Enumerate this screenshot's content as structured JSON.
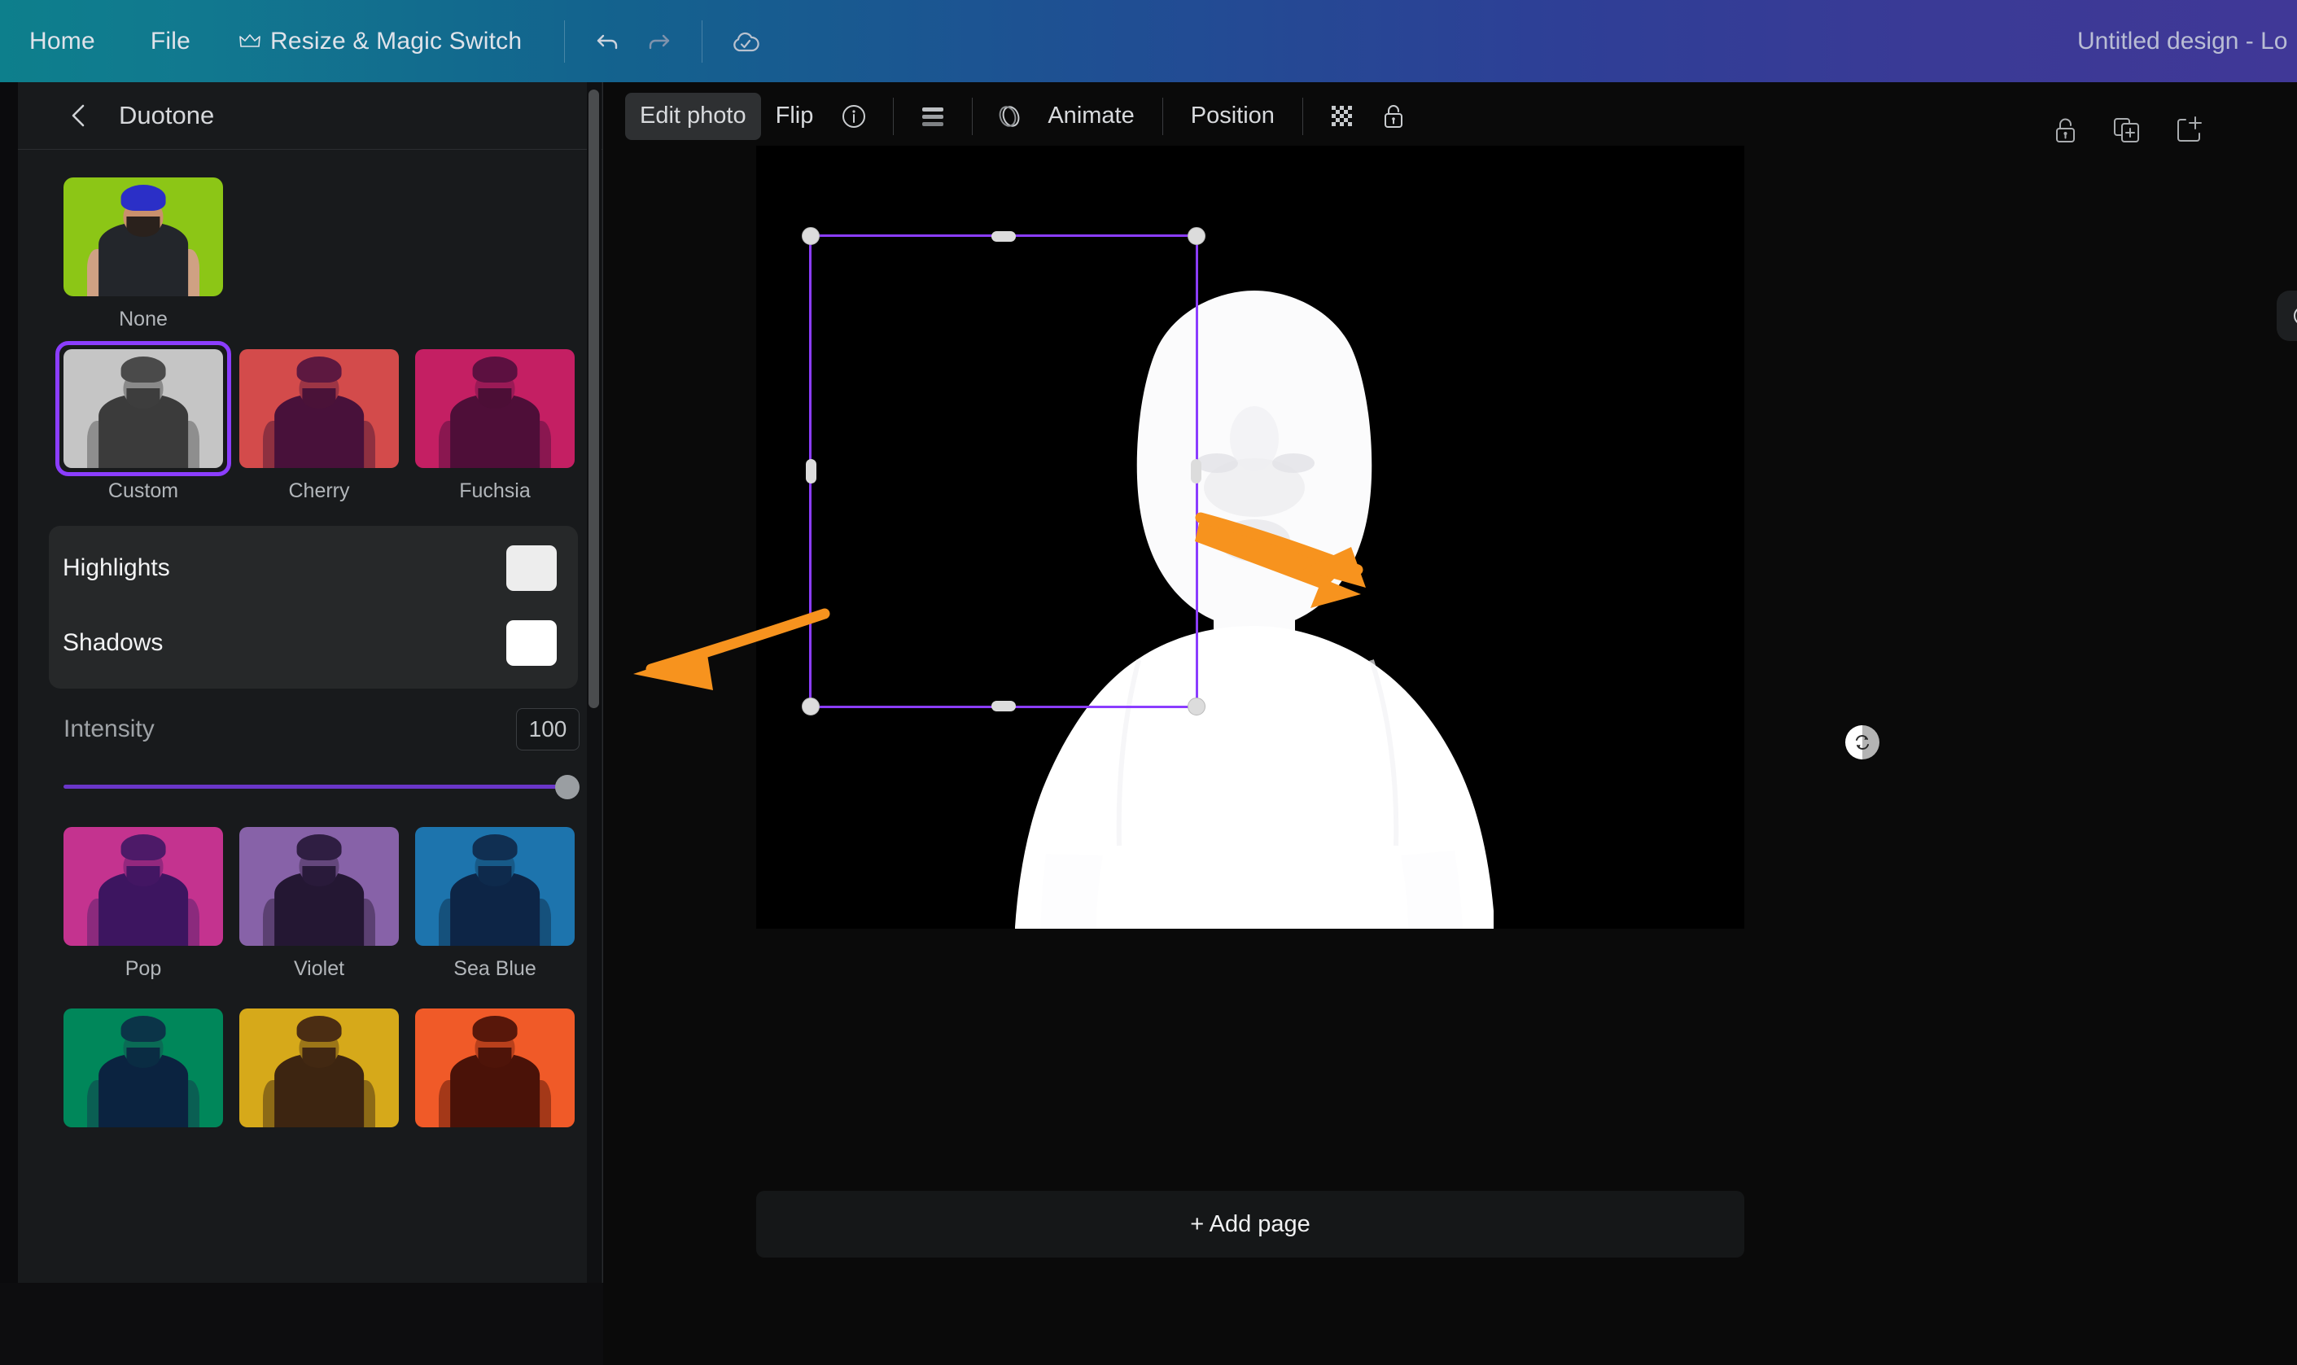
{
  "app": {
    "accent_purple": "#8b3dff",
    "annotation_color": "#f7931e",
    "panel_bg": "#181a1c",
    "canvas_bg": "#0a0a0a"
  },
  "topbar": {
    "menu": [
      {
        "label": "Home",
        "icon": null
      },
      {
        "label": "File",
        "icon": null
      },
      {
        "label": "Resize & Magic Switch",
        "icon": "crown-icon"
      }
    ],
    "undo_icon": "undo-icon",
    "redo_icon": "redo-icon",
    "save_status_icon": "cloud-check-icon",
    "document_title": "Untitled design - Lo"
  },
  "panel": {
    "back_icon": "chevron-left-icon",
    "title": "Duotone",
    "none": {
      "label": "None",
      "bg": "#8cc616",
      "selected": false
    },
    "presets_row1": [
      {
        "label": "Custom",
        "selected": true,
        "bg": "#c9c9c9",
        "fg": "#3a3a3a"
      },
      {
        "label": "Cherry",
        "selected": false,
        "bg": "#d34b4b",
        "fg": "#3f1030"
      },
      {
        "label": "Fuchsia",
        "selected": false,
        "bg": "#c41f63",
        "fg": "#4a0f35"
      }
    ],
    "controls": {
      "highlights": {
        "label": "Highlights",
        "color": "#ededed"
      },
      "shadows": {
        "label": "Shadows",
        "color": "#ffffff"
      },
      "intensity": {
        "label": "Intensity",
        "value": "100",
        "percent": 100
      }
    },
    "presets_row2": [
      {
        "label": "Pop",
        "selected": false,
        "bg": "#c4338f",
        "fg": "#3d1560"
      },
      {
        "label": "Violet",
        "selected": false,
        "bg": "#8762a8",
        "fg": "#241733"
      },
      {
        "label": "Sea Blue",
        "selected": false,
        "bg": "#1d74ad",
        "fg": "#0d2546"
      }
    ],
    "presets_row3": [
      {
        "label": "",
        "selected": false,
        "bg": "#00875a",
        "fg": "#0b2340"
      },
      {
        "label": "",
        "selected": false,
        "bg": "#d6a91a",
        "fg": "#3d2511"
      },
      {
        "label": "",
        "selected": false,
        "bg": "#f05a28",
        "fg": "#4a1208"
      }
    ],
    "scrollbar": true
  },
  "toolbar": {
    "edit_photo": "Edit photo",
    "flip": "Flip",
    "info_icon": "info-icon",
    "lines_icon": "transparency-lines-icon",
    "animate_icon": "animate-icon",
    "animate": "Animate",
    "position": "Position",
    "grid_icon": "transparency-grid-icon",
    "lock_icon": "lock-icon"
  },
  "canvas": {
    "page_icons": [
      "lock-icon",
      "duplicate-page-icon",
      "add-page-icon"
    ],
    "comment_icon": "comment-bubble-icon",
    "rotate_icon": "rotate-handle-icon",
    "add_page_label": "+ Add page",
    "selection": {
      "active": true,
      "handles": 8
    }
  },
  "annotations": [
    {
      "name": "arrow-to-canvas-image",
      "color": "#f7931e"
    },
    {
      "name": "arrow-to-highlights-control",
      "color": "#f7931e"
    }
  ]
}
